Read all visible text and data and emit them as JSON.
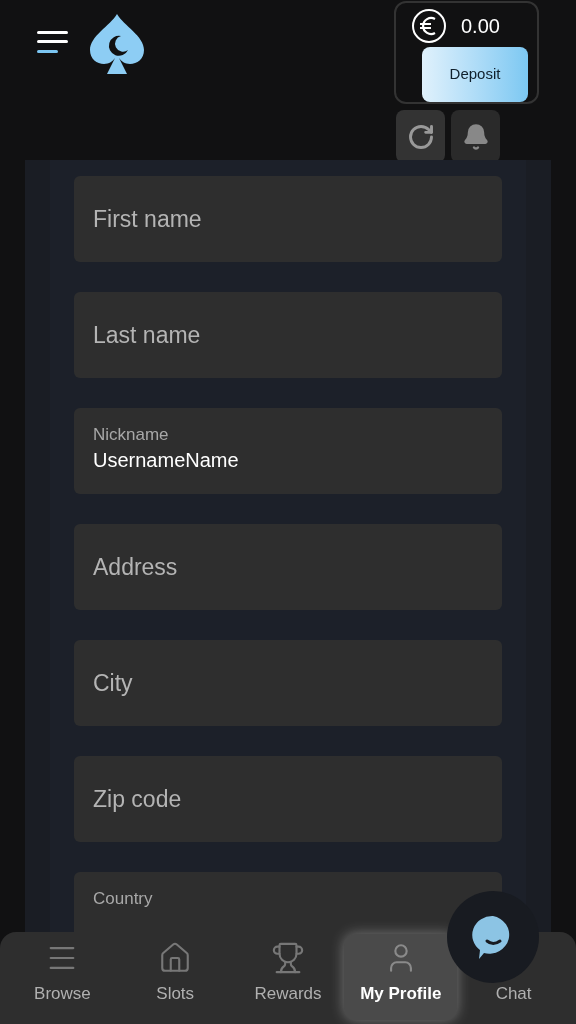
{
  "header": {
    "balance": "0.00",
    "deposit_button": "Deposit"
  },
  "form": {
    "fields": [
      {
        "kind": "empty",
        "placeholder": "First name"
      },
      {
        "kind": "empty",
        "placeholder": "Last name"
      },
      {
        "kind": "filled",
        "label": "Nickname",
        "value": "UsernameName"
      },
      {
        "kind": "empty",
        "placeholder": "Address"
      },
      {
        "kind": "empty",
        "placeholder": "City"
      },
      {
        "kind": "empty",
        "placeholder": "Zip code"
      },
      {
        "kind": "label_only",
        "label": "Country"
      }
    ]
  },
  "bottom_nav": [
    {
      "kind": "browse",
      "label": "Browse",
      "selected": false
    },
    {
      "kind": "slots",
      "label": "Slots",
      "selected": false
    },
    {
      "kind": "rewards",
      "label": "Rewards",
      "selected": false
    },
    {
      "kind": "profile",
      "label": "My Profile",
      "selected": true
    },
    {
      "kind": "chat",
      "label": "Chat",
      "selected": false
    }
  ]
}
